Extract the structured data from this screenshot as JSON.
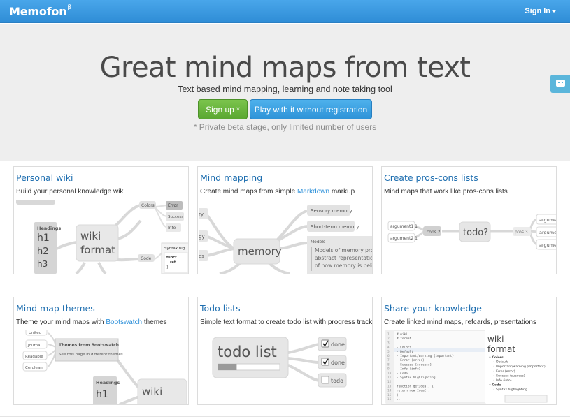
{
  "navbar": {
    "brand": "Memofon",
    "brand_sup": "β",
    "signin_label": "Sign In"
  },
  "hero": {
    "headline": "Great mind maps from text",
    "tagline": "Text based mind mapping, learning and note taking tool",
    "signup_label": "Sign up *",
    "play_label": "Play with it without registration",
    "note": "* Private beta stage, only limited number of users"
  },
  "cards": [
    {
      "title": "Personal wiki",
      "desc": "Build your personal knowledge wiki",
      "thumb": {
        "center": [
          "wiki",
          "format"
        ],
        "headings_label": "Headings",
        "headings": [
          "h1",
          "h2",
          "h3"
        ],
        "colors": "Colors",
        "color_items": [
          "Error",
          "Success",
          "Info"
        ],
        "code": "Code",
        "syntax": "Syntax hig",
        "code_lines": [
          "funct",
          "ret",
          "}"
        ]
      }
    },
    {
      "title": "Mind mapping",
      "desc_before": "Create mind maps from simple ",
      "desc_link": "Markdown",
      "desc_after": "  markup",
      "thumb": {
        "center": "memory",
        "branches": [
          "Sensory memory",
          "Short-term memory",
          "Models"
        ],
        "model_text": [
          "Models of memory pro",
          "abstract representatio",
          "of how memory is beli"
        ],
        "left_stubs": [
          "ry",
          "gy",
          "es"
        ]
      }
    },
    {
      "title": "Create pros-cons lists",
      "desc": "Mind maps that work like pros-cons lists",
      "thumb": {
        "center": "todo?",
        "left": [
          "argument1 1",
          "argument2 1",
          "cons 2"
        ],
        "right": [
          "pros 3",
          "argumen",
          "argumen",
          "argumen"
        ]
      }
    },
    {
      "title": "Mind map themes",
      "desc_before": "Theme your mind maps with ",
      "desc_link": "Bootswatch",
      "desc_after": "  themes",
      "thumb": {
        "themes": [
          "United",
          "Journal",
          "Readable",
          "Cerulean"
        ],
        "box_title": "Themes from Bootswatch",
        "box_text": "See this page in different themes",
        "headings_label": "Headings",
        "h1": "h1",
        "center": "wiki"
      }
    },
    {
      "title": "Todo lists",
      "desc": "Simple text format to create todo list with progress tracking",
      "thumb": {
        "center": "todo list",
        "progress": 0.3,
        "items": [
          {
            "label": "done",
            "checked": true
          },
          {
            "label": "done",
            "checked": true
          },
          {
            "label": "todo",
            "checked": false
          }
        ]
      }
    },
    {
      "title": "Share your knowledge",
      "desc": "Create linked mind maps, refcards, presentations",
      "thumb": {
        "editor_lines": [
          "# wiki",
          "# format",
          "",
          "- Colors",
          "  - Default",
          "  - Important/warning {important}",
          "  - Error {error}",
          "  - Success {success}",
          "  - Info {info}",
          "- Code",
          "  - Syntax highlighting",
          "",
          "    function getIdea() {",
          "      return new Idea();",
          "    }",
          "    ..."
        ],
        "preview_title": [
          "wiki",
          "format"
        ],
        "preview_items": [
          "Colors",
          "Default",
          "Important/warning (important)",
          "Error (error)",
          "Success (success)",
          "Info (info)",
          "Code",
          "Syntax highlighting",
          "function getIdea() {"
        ]
      }
    }
  ]
}
